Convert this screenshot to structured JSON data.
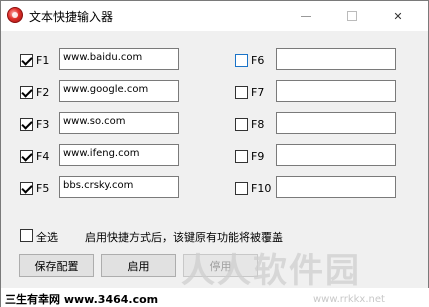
{
  "window": {
    "title": "文本快捷输入器",
    "minimize_glyph": "",
    "close_glyph": "✕"
  },
  "shortcuts_left": [
    {
      "key": "F1",
      "checked": true,
      "value": "www.baidu.com"
    },
    {
      "key": "F2",
      "checked": true,
      "value": "www.google.com"
    },
    {
      "key": "F3",
      "checked": true,
      "value": "www.so.com"
    },
    {
      "key": "F4",
      "checked": true,
      "value": "www.ifeng.com"
    },
    {
      "key": "F5",
      "checked": true,
      "value": "bbs.crsky.com"
    }
  ],
  "shortcuts_right": [
    {
      "key": "F6",
      "checked": false,
      "value": ""
    },
    {
      "key": "F7",
      "checked": false,
      "value": ""
    },
    {
      "key": "F8",
      "checked": false,
      "value": ""
    },
    {
      "key": "F9",
      "checked": false,
      "value": ""
    },
    {
      "key": "F10",
      "checked": false,
      "value": ""
    }
  ],
  "select_all": {
    "label": "全选",
    "checked": false
  },
  "notice": "启用快捷方式后，该键原有功能将被覆盖",
  "buttons": {
    "save": "保存配置",
    "enable": "启用",
    "disable": "停用"
  },
  "footer": {
    "text": "三生有幸网 www.3464.com"
  },
  "watermark": {
    "text": "人人软件园",
    "url": "www.rrkkx.net"
  },
  "colors": {
    "window_bg": "#f0f0f0",
    "focus_blue": "#1a73c8"
  }
}
